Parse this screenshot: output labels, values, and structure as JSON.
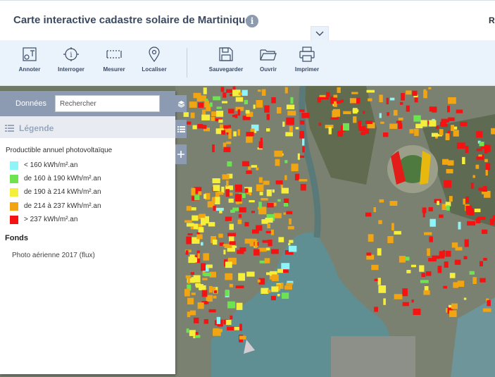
{
  "header": {
    "title": "Carte interactive cadastre solaire de Martinique",
    "right_text": "R"
  },
  "toolbar": {
    "tools": [
      {
        "label": "Annoter",
        "icon": "annotate-icon"
      },
      {
        "label": "Interroger",
        "icon": "query-icon"
      },
      {
        "label": "Mesurer",
        "icon": "measure-icon"
      },
      {
        "label": "Localiser",
        "icon": "locate-icon"
      },
      {
        "label": "Sauvegarder",
        "icon": "save-icon"
      },
      {
        "label": "Ouvrir",
        "icon": "folder-icon"
      },
      {
        "label": "Imprimer",
        "icon": "print-icon"
      }
    ]
  },
  "panel": {
    "tab_label": "Données",
    "search_placeholder": "Rechercher",
    "legend_label": "Légende",
    "layer_title": "Productible annuel photovoltaïque",
    "legend_items": [
      {
        "label": "< 160 kWh/m².an",
        "color": "#8ff4f8"
      },
      {
        "label": "de 160 à 190 kWh/m².an",
        "color": "#6de34f"
      },
      {
        "label": "de 190 à 214 kWh/m².an",
        "color": "#f5ee3a"
      },
      {
        "label": "de 214 à 237 kWh/m².an",
        "color": "#f2a513"
      },
      {
        "label": "> 237 kWh/m².an",
        "color": "#f41212"
      }
    ],
    "basemap_group": "Fonds",
    "basemap_item": "Photo aérienne 2017 (flux)"
  },
  "colors": {
    "accent": "#8c9bb2",
    "toolbar_bg": "#eaf2fb",
    "title_text": "#3b4a61"
  }
}
